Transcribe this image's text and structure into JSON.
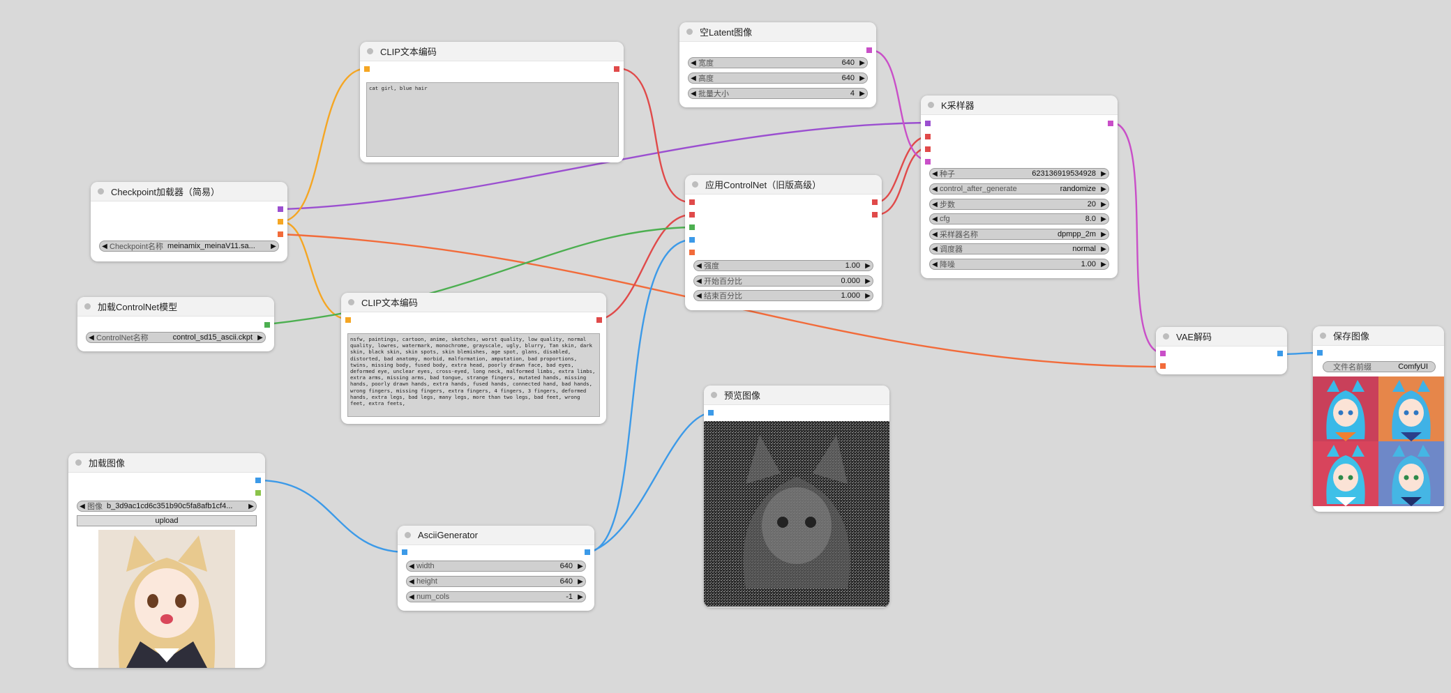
{
  "colors": {
    "canvas_bg": "#d9d9d9",
    "model": "#9b4fd0",
    "clip": "#f5a623",
    "conditioning": "#e04a4a",
    "control_net": "#4caf50",
    "image": "#3c9ae8",
    "vae": "#f26b3a",
    "latent": "#c94fc8",
    "mask": "#8bc34a"
  },
  "nodes": {
    "clip_pos": {
      "title": "CLIP文本编码",
      "text": "cat girl, blue hair"
    },
    "empty_latent": {
      "title": "空Latent图像",
      "widgets": [
        {
          "label": "宽度",
          "value": "640"
        },
        {
          "label": "高度",
          "value": "640"
        },
        {
          "label": "批量大小",
          "value": "4"
        }
      ]
    },
    "ksampler": {
      "title": "K采样器",
      "widgets": [
        {
          "label": "种子",
          "value": "623136919534928"
        },
        {
          "label": "control_after_generate",
          "value": "randomize"
        },
        {
          "label": "步数",
          "value": "20"
        },
        {
          "label": "cfg",
          "value": "8.0"
        },
        {
          "label": "采样器名称",
          "value": "dpmpp_2m"
        },
        {
          "label": "调度器",
          "value": "normal"
        },
        {
          "label": "降噪",
          "value": "1.00"
        }
      ]
    },
    "checkpoint": {
      "title": "Checkpoint加载器（简易）",
      "widgets": [
        {
          "label": "Checkpoint名称",
          "value": "meinamix_meinaV11.sa..."
        }
      ]
    },
    "controlnet_apply": {
      "title": "应用ControlNet（旧版高级）",
      "widgets": [
        {
          "label": "强度",
          "value": "1.00"
        },
        {
          "label": "开始百分比",
          "value": "0.000"
        },
        {
          "label": "结束百分比",
          "value": "1.000"
        }
      ]
    },
    "controlnet_loader": {
      "title": "加载ControlNet模型",
      "widgets": [
        {
          "label": "ControlNet名称",
          "value": "control_sd15_ascii.ckpt"
        }
      ]
    },
    "clip_neg": {
      "title": "CLIP文本编码",
      "text": "nsfw, paintings, cartoon, anime, sketches, worst quality, low quality, normal quality, lowres, watermark, monochrome, grayscale, ugly, blurry, Tan skin, dark skin, black skin, skin spots, skin blemishes, age spot, glans, disabled, distorted, bad anatomy, morbid, malformation, amputation, bad proportions, twins, missing body, fused body, extra head, poorly drawn face, bad eyes, deformed eye, unclear eyes, cross-eyed, long neck, malformed limbs, extra limbs, extra arms, missing arms, bad tongue, strange fingers, mutated hands, missing hands, poorly drawn hands, extra hands, fused hands, connected hand, bad hands, wrong fingers, missing fingers, extra fingers, 4 fingers, 3 fingers, deformed hands, extra legs, bad legs, many legs, more than two legs, bad feet, wrong feet, extra feets,"
    },
    "vae_decode": {
      "title": "VAE解码"
    },
    "save_image": {
      "title": "保存图像",
      "widgets": [
        {
          "label": "文件名前缀",
          "value": "ComfyUI"
        }
      ]
    },
    "preview_image": {
      "title": "预览图像"
    },
    "load_image": {
      "title": "加载图像",
      "widgets": [
        {
          "label": "图像",
          "value": "b_3d9ac1cd6c351b90c5fa8afb1cf4..."
        }
      ],
      "upload_label": "upload"
    },
    "ascii_gen": {
      "title": "AsciiGenerator",
      "widgets": [
        {
          "label": "width",
          "value": "640"
        },
        {
          "label": "height",
          "value": "640"
        },
        {
          "label": "num_cols",
          "value": "-1"
        }
      ]
    }
  }
}
